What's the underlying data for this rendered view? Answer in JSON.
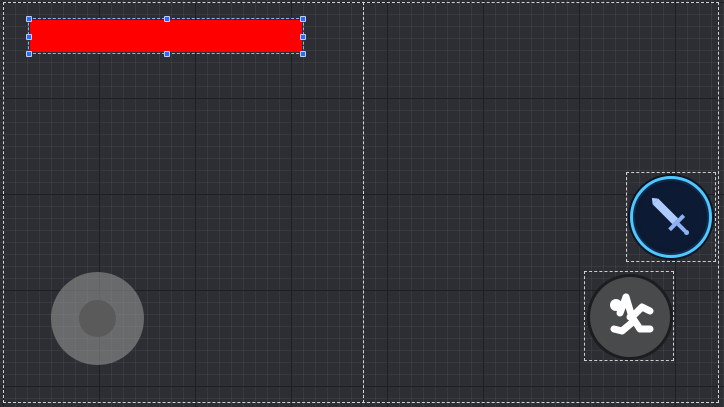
{
  "hud": {
    "health": {
      "fraction": 1.0,
      "color": "#ff0000"
    },
    "joystick": {
      "label": "virtual-joystick"
    },
    "attack_button": {
      "icon": "sword-icon",
      "accent": "#4fc8ff"
    },
    "dash_button": {
      "icon": "running-figure-icon"
    }
  }
}
